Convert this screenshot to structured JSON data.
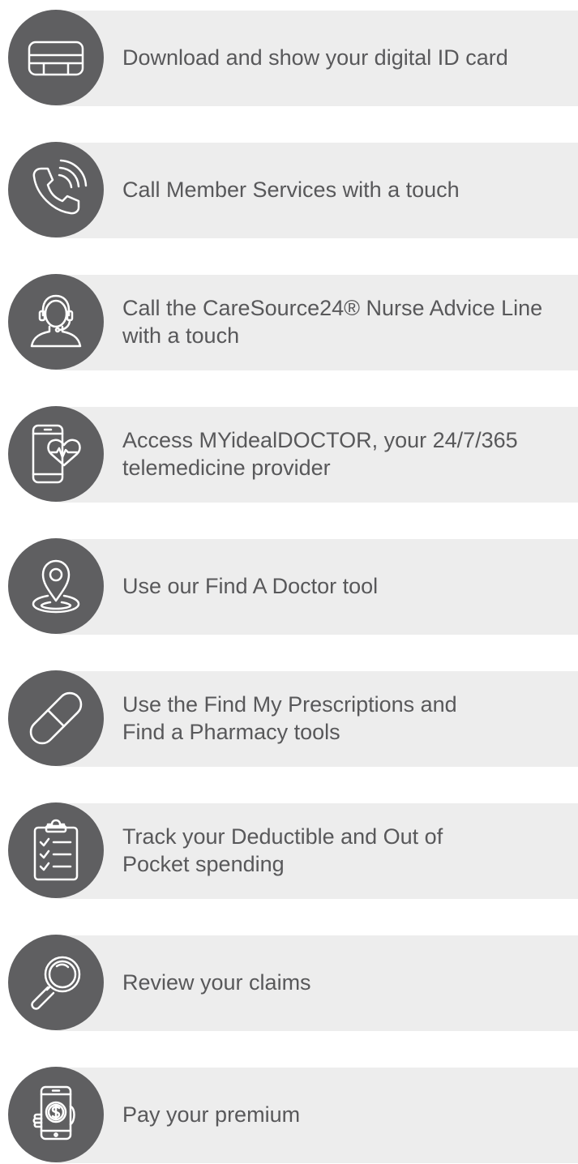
{
  "features": [
    {
      "label": "Download and show your digital ID card",
      "icon": "id-card-icon"
    },
    {
      "label": "Call Member Services with a touch",
      "icon": "phone-icon"
    },
    {
      "label": "Call the CareSource24® Nurse Advice Line\nwith a touch",
      "icon": "nurse-headset-icon"
    },
    {
      "label": "Access MYidealDOCTOR, your 24/7/365\ntelemedicine provider",
      "icon": "telemedicine-phone-icon"
    },
    {
      "label": "Use our Find A Doctor tool",
      "icon": "location-pin-icon"
    },
    {
      "label": "Use the Find My Prescriptions and\nFind a Pharmacy tools",
      "icon": "pill-icon"
    },
    {
      "label": "Track your Deductible and Out of\nPocket spending",
      "icon": "clipboard-checklist-icon"
    },
    {
      "label": "Review your claims",
      "icon": "magnifier-icon"
    },
    {
      "label": "Pay your premium",
      "icon": "payment-phone-icon"
    }
  ],
  "colors": {
    "circle": "#5f5f61",
    "pill": "#ededed",
    "text": "#58585a"
  }
}
